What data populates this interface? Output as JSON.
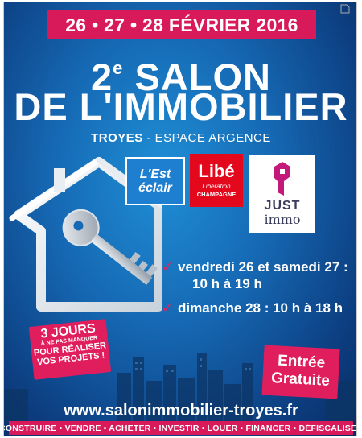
{
  "header": {
    "dates": "26 • 27 • 28 FÉVRIER 2016"
  },
  "title": {
    "number": "2",
    "ordinal_suffix": "e",
    "line1_word": "SALON",
    "line2": "DE L'IMMOBILIER"
  },
  "location": {
    "city": "TROYES",
    "separator": " - ",
    "venue": "ESPACE ARGENCE"
  },
  "logos": {
    "est_eclair": {
      "line1": "L'Est",
      "line2": "éclair"
    },
    "libe": {
      "line1": "Libé",
      "line2": "Libération",
      "line3": "CHAMPAGNE"
    },
    "just_immo": {
      "line1": "JUST",
      "line2": "immo"
    }
  },
  "schedule": {
    "check_glyph": "✓",
    "item1_line1": "vendredi 26 et samedi 27 :",
    "item1_line2": "10 h à 19 h",
    "item2": "dimanche 28 : 10 h à 18 h"
  },
  "badge_jours": {
    "line1": "3 JOURS",
    "line2": "À NE PAS MANQUER",
    "line3": "POUR RÉALISER",
    "line4": "VOS PROJETS !"
  },
  "badge_entree": {
    "line1": "Entrée",
    "line2": "Gratuite"
  },
  "website": "www.salonimmobilier-troyes.fr",
  "footer": "CONSTRUIRE • VENDRE • ACHETER • INVESTIR • LOUER • FINANCER • DÉFISCALISER",
  "colors": {
    "accent_pink": "#d91a5a",
    "background_blue": "#1669b4",
    "libe_red": "#e3081b",
    "est_blue": "#1e7fd0"
  },
  "icons": [
    "house-key-illustration",
    "checkmark-icon",
    "city-skyline-illustration"
  ]
}
